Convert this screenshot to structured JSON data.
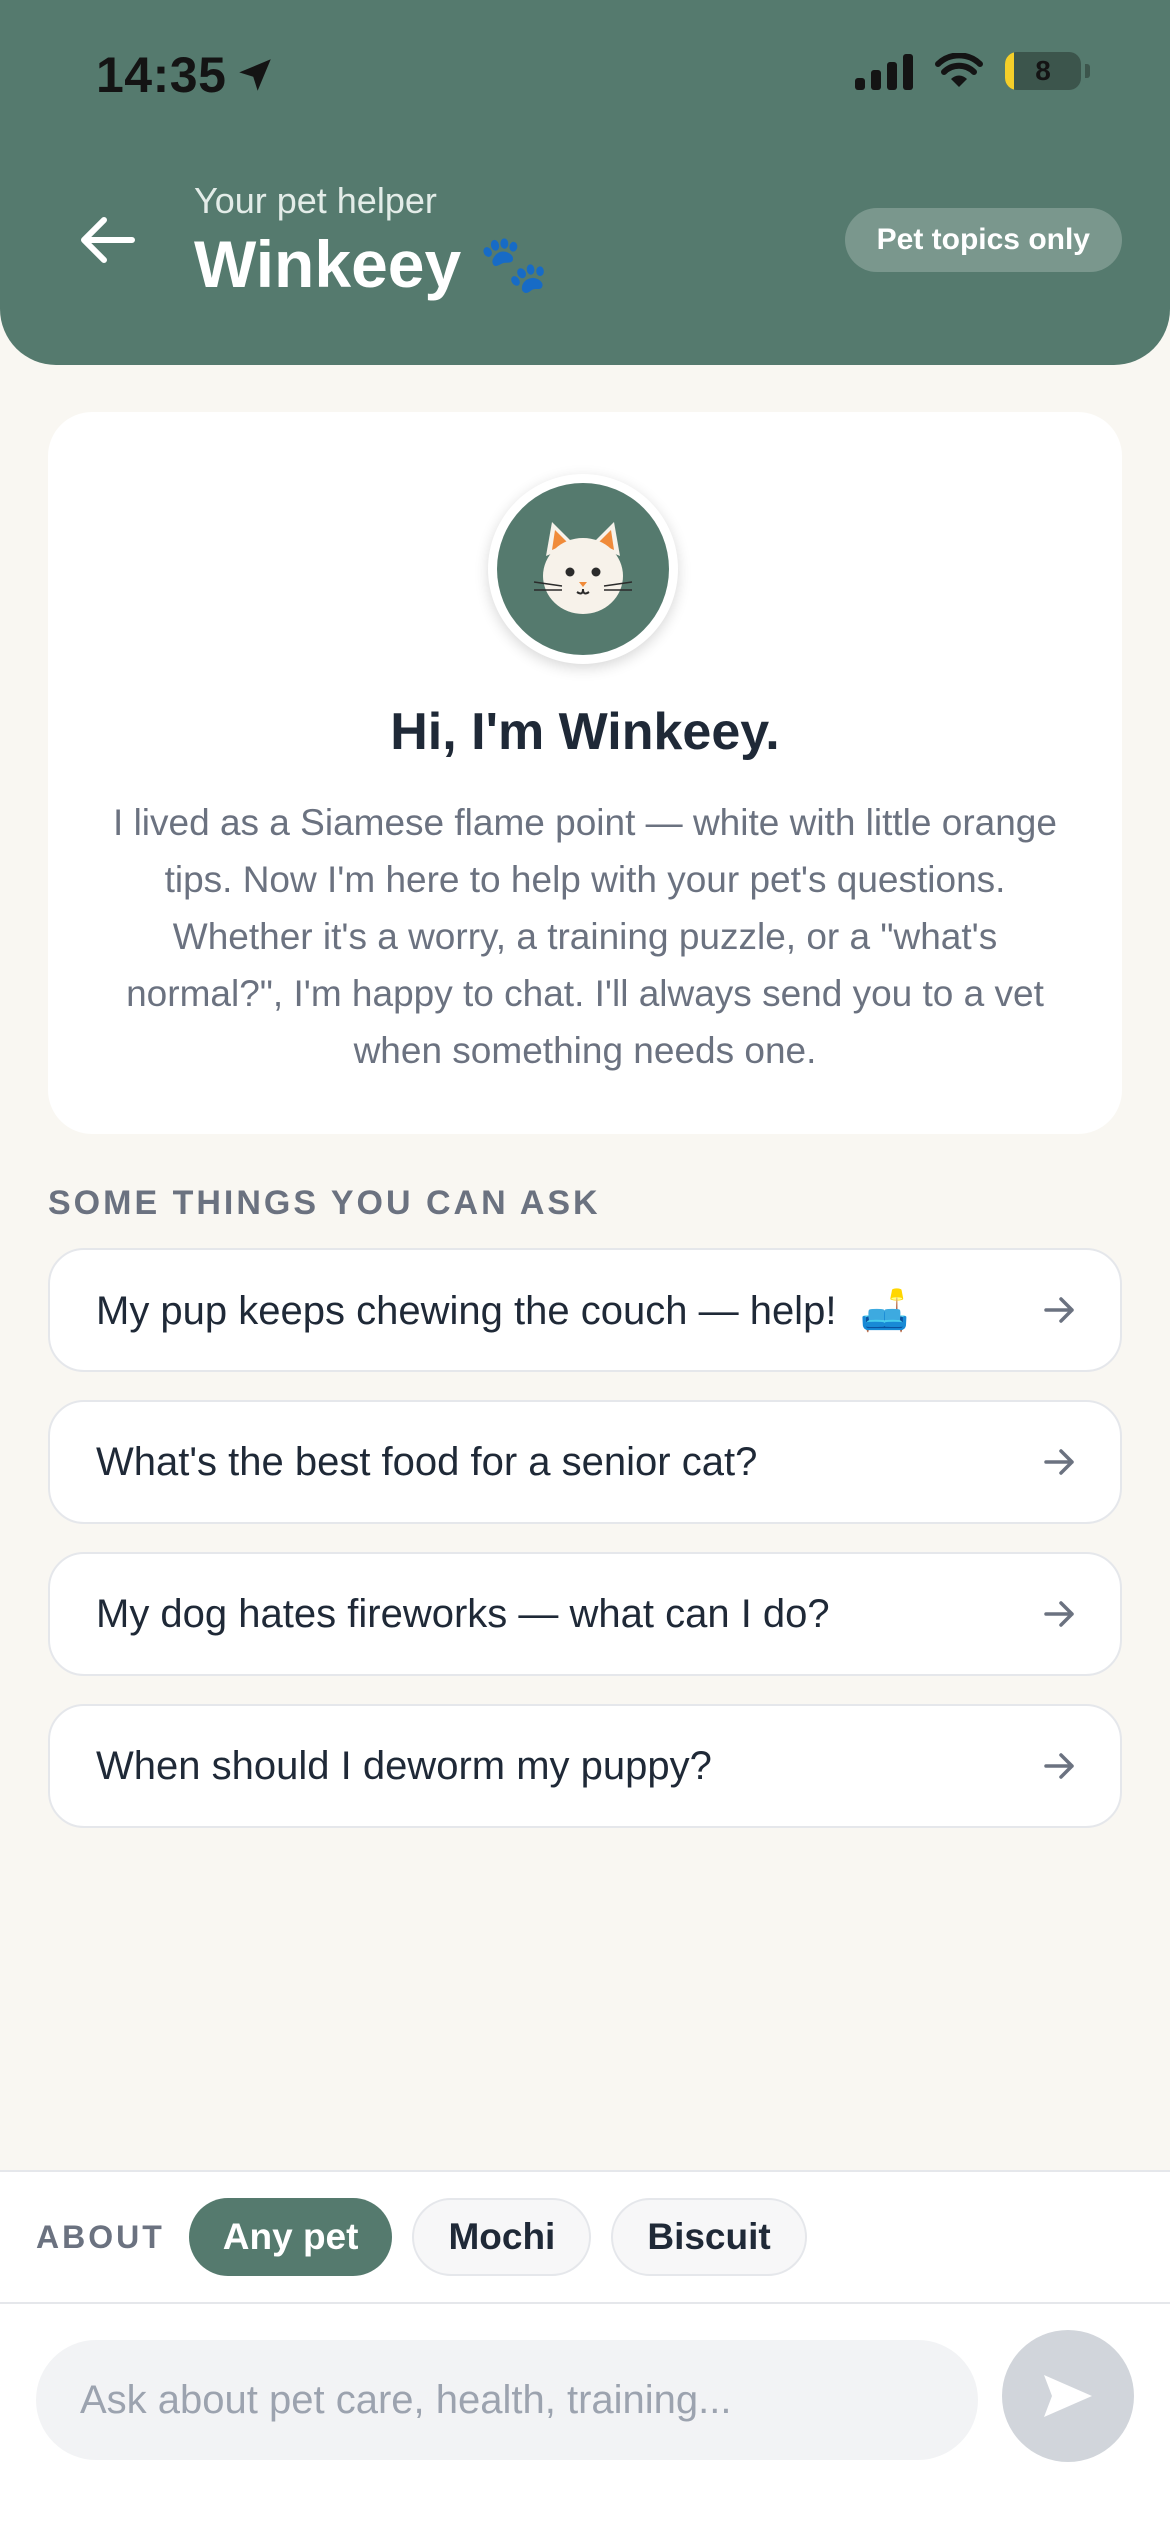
{
  "status_bar": {
    "time": "14:35",
    "battery": "8"
  },
  "header": {
    "subtitle": "Your pet helper",
    "title": "Winkeey",
    "paw_emoji": "🐾",
    "badge": "Pet topics only"
  },
  "intro": {
    "greeting": "Hi, I'm Winkeey.",
    "bio": "I lived as a Siamese flame point — white with little orange tips. Now I'm here to help with your pet's questions. Whether it's a worry, a training puzzle, or a \"what's normal?\", I'm happy to chat. I'll always send you to a vet when something needs one."
  },
  "suggestions": {
    "label": "SOME THINGS YOU CAN ASK",
    "items": [
      {
        "text": "My pup keeps chewing the couch — help!",
        "emoji": "🛋️"
      },
      {
        "text": "What's the best food for a senior cat?"
      },
      {
        "text": "My dog hates fireworks — what can I do?"
      },
      {
        "text": "When should I deworm my puppy?"
      }
    ]
  },
  "about": {
    "label": "ABOUT",
    "chips": [
      "Any pet",
      "Mochi",
      "Biscuit"
    ],
    "selected": "Any pet"
  },
  "composer": {
    "placeholder": "Ask about pet care, health, training..."
  },
  "colors": {
    "brand": "#557a6e",
    "background": "#f9f7f2"
  }
}
